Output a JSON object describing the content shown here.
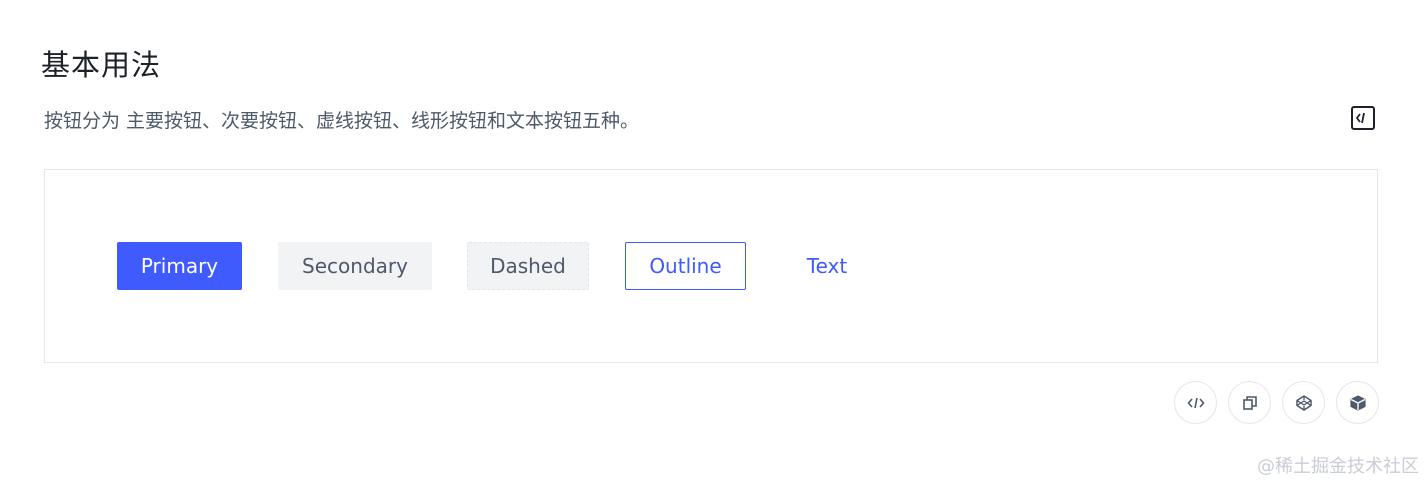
{
  "section": {
    "title": "基本用法",
    "description": "按钮分为 主要按钮、次要按钮、虚线按钮、线形按钮和文本按钮五种。"
  },
  "icons": {
    "code_toggle": "code-bracket-icon",
    "actions": [
      "code-icon",
      "copy-icon",
      "codepen-icon",
      "codesandbox-icon"
    ]
  },
  "buttons": {
    "primary": "Primary",
    "secondary": "Secondary",
    "dashed": "Dashed",
    "outline": "Outline",
    "text": "Text"
  },
  "colors": {
    "primary": "#3f5bfd",
    "secondary_bg": "#f2f3f5",
    "text_muted": "#4e5969",
    "border": "#e5e6eb"
  },
  "watermark": "@稀土掘金技术社区"
}
